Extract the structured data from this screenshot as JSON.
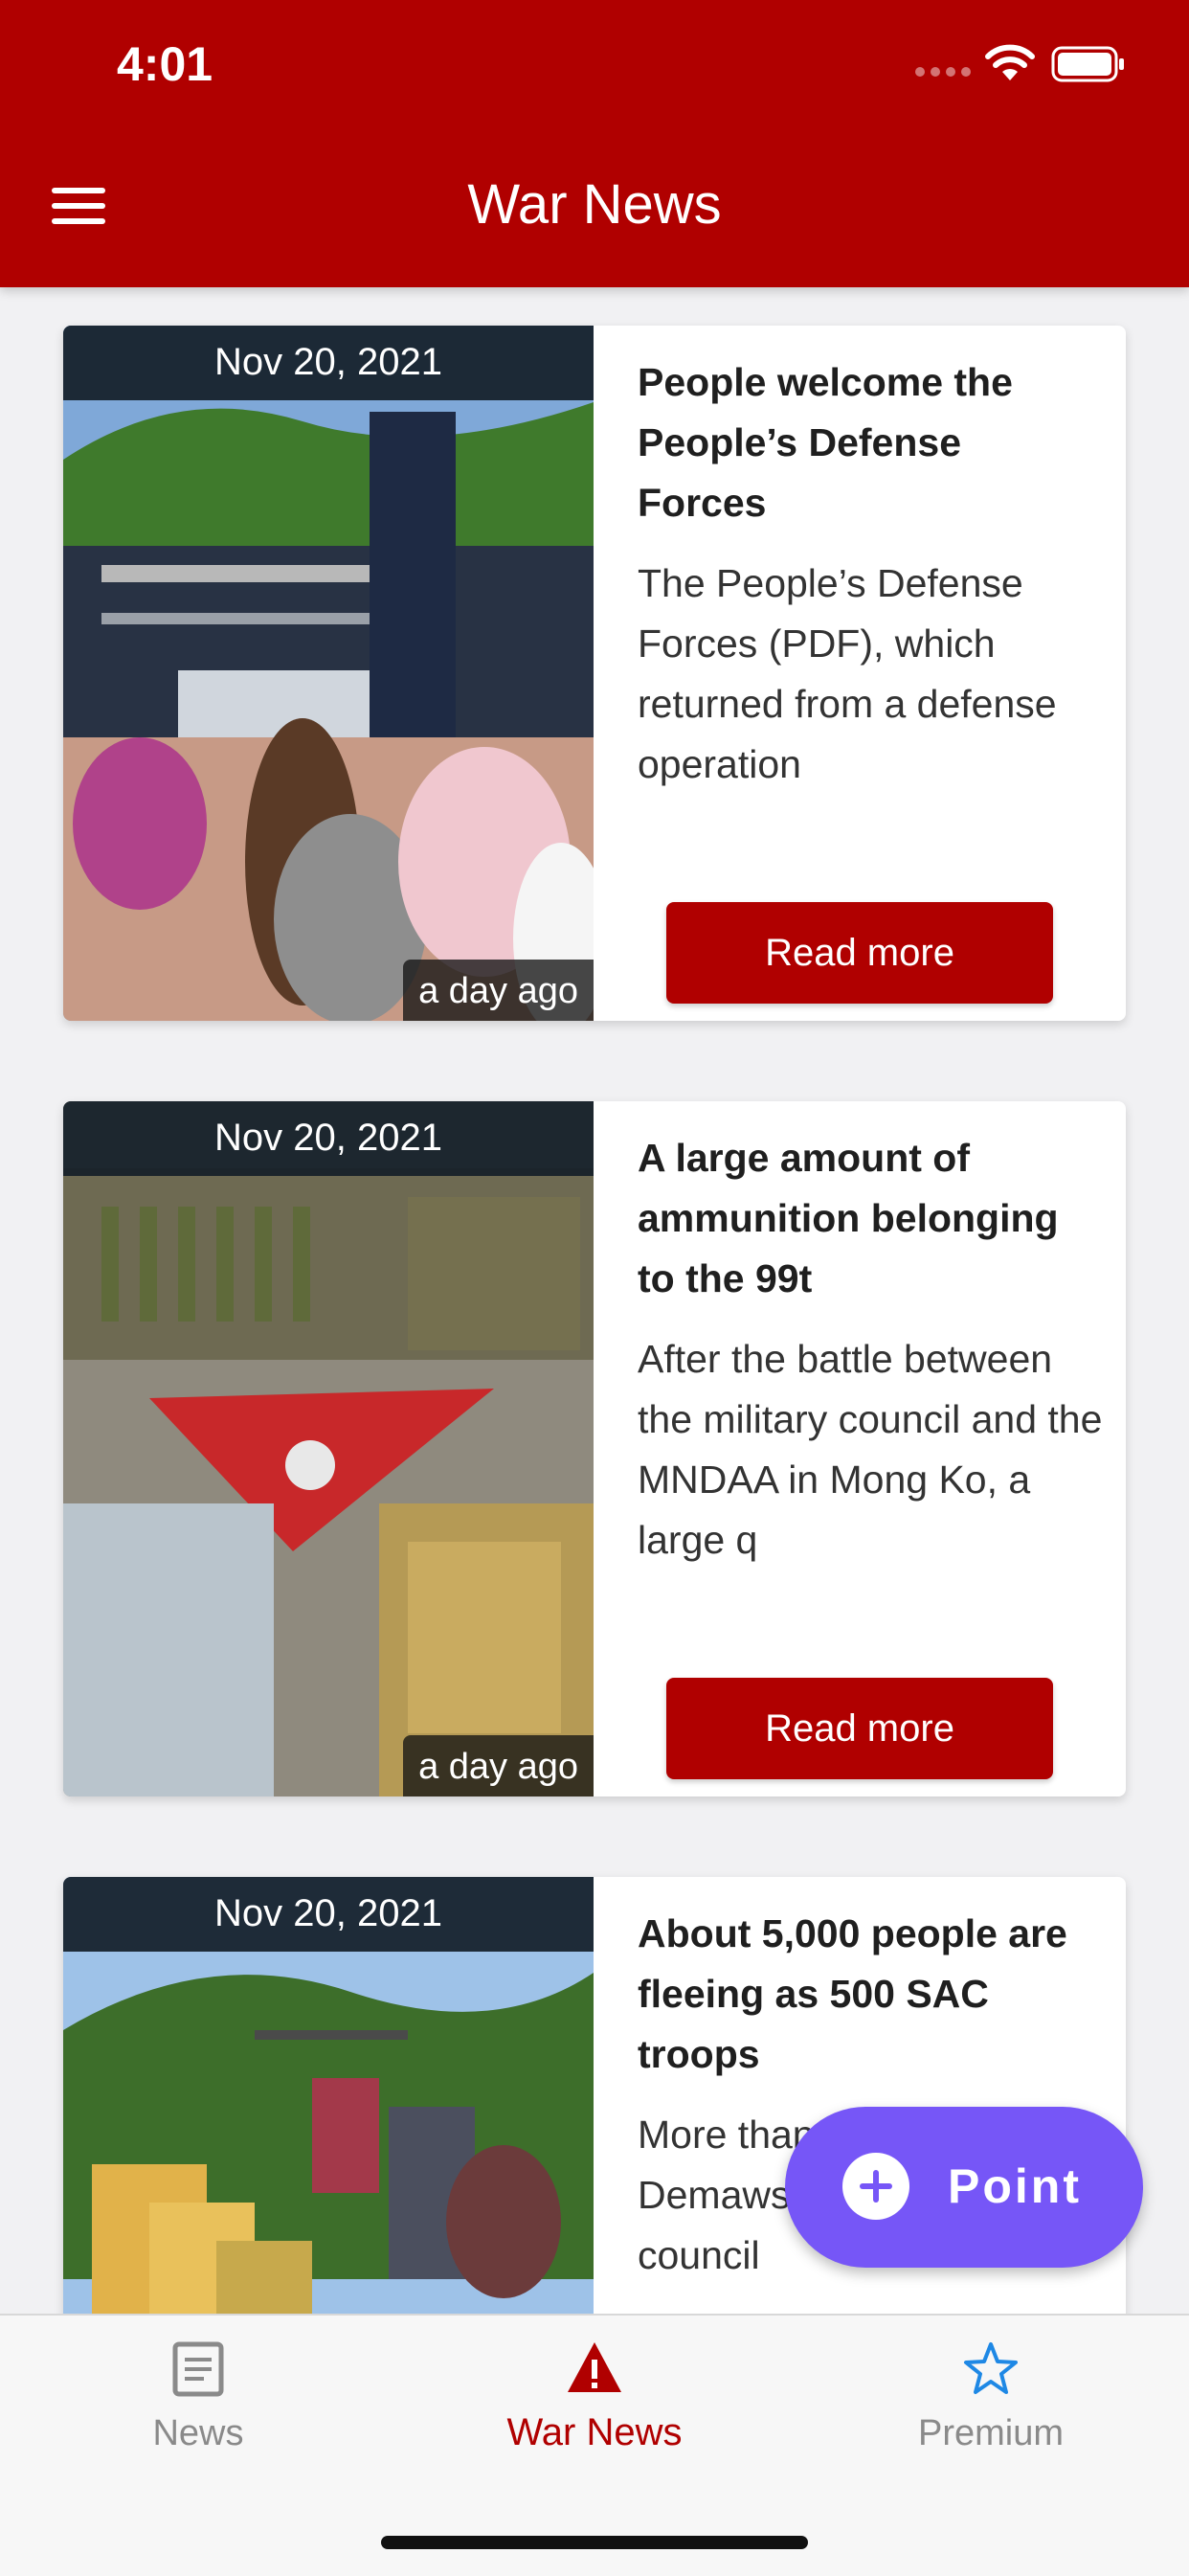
{
  "status_bar": {
    "time": "4:01"
  },
  "header": {
    "title": "War News",
    "menu_icon": "hamburger-menu-icon"
  },
  "colors": {
    "brand": "#b00000",
    "fab": "#7656f7",
    "tab_active": "#b00000",
    "tab_premium": "#1e88e5",
    "tab_inactive": "#8a8a8a"
  },
  "articles": [
    {
      "date": "Nov 20, 2021",
      "ago": "a day ago",
      "title": "People welcome the People’s Defense Forces",
      "excerpt": "The People’s Defense Forces (PDF), which returned from a defense operation",
      "button": "Read more"
    },
    {
      "date": "Nov 20, 2021",
      "ago": "a day ago",
      "title": "A large amount of ammunition belonging to the 99t",
      "excerpt": "After the battle between the military council and the MNDAA in Mong Ko, a large q",
      "button": "Read more"
    },
    {
      "date": "Nov 20, 2021",
      "ago": "",
      "title": "About 5,000 people are fleeing as 500 SAC troops",
      "excerpt": "More than … in Moe B… Demawso … the military council",
      "button": ""
    }
  ],
  "fab": {
    "label": "Point",
    "icon": "plus-circle-icon"
  },
  "tabs": [
    {
      "label": "News",
      "icon": "news-document-icon"
    },
    {
      "label": "War News",
      "icon": "warning-triangle-icon"
    },
    {
      "label": "Premium",
      "icon": "star-outline-icon"
    }
  ]
}
